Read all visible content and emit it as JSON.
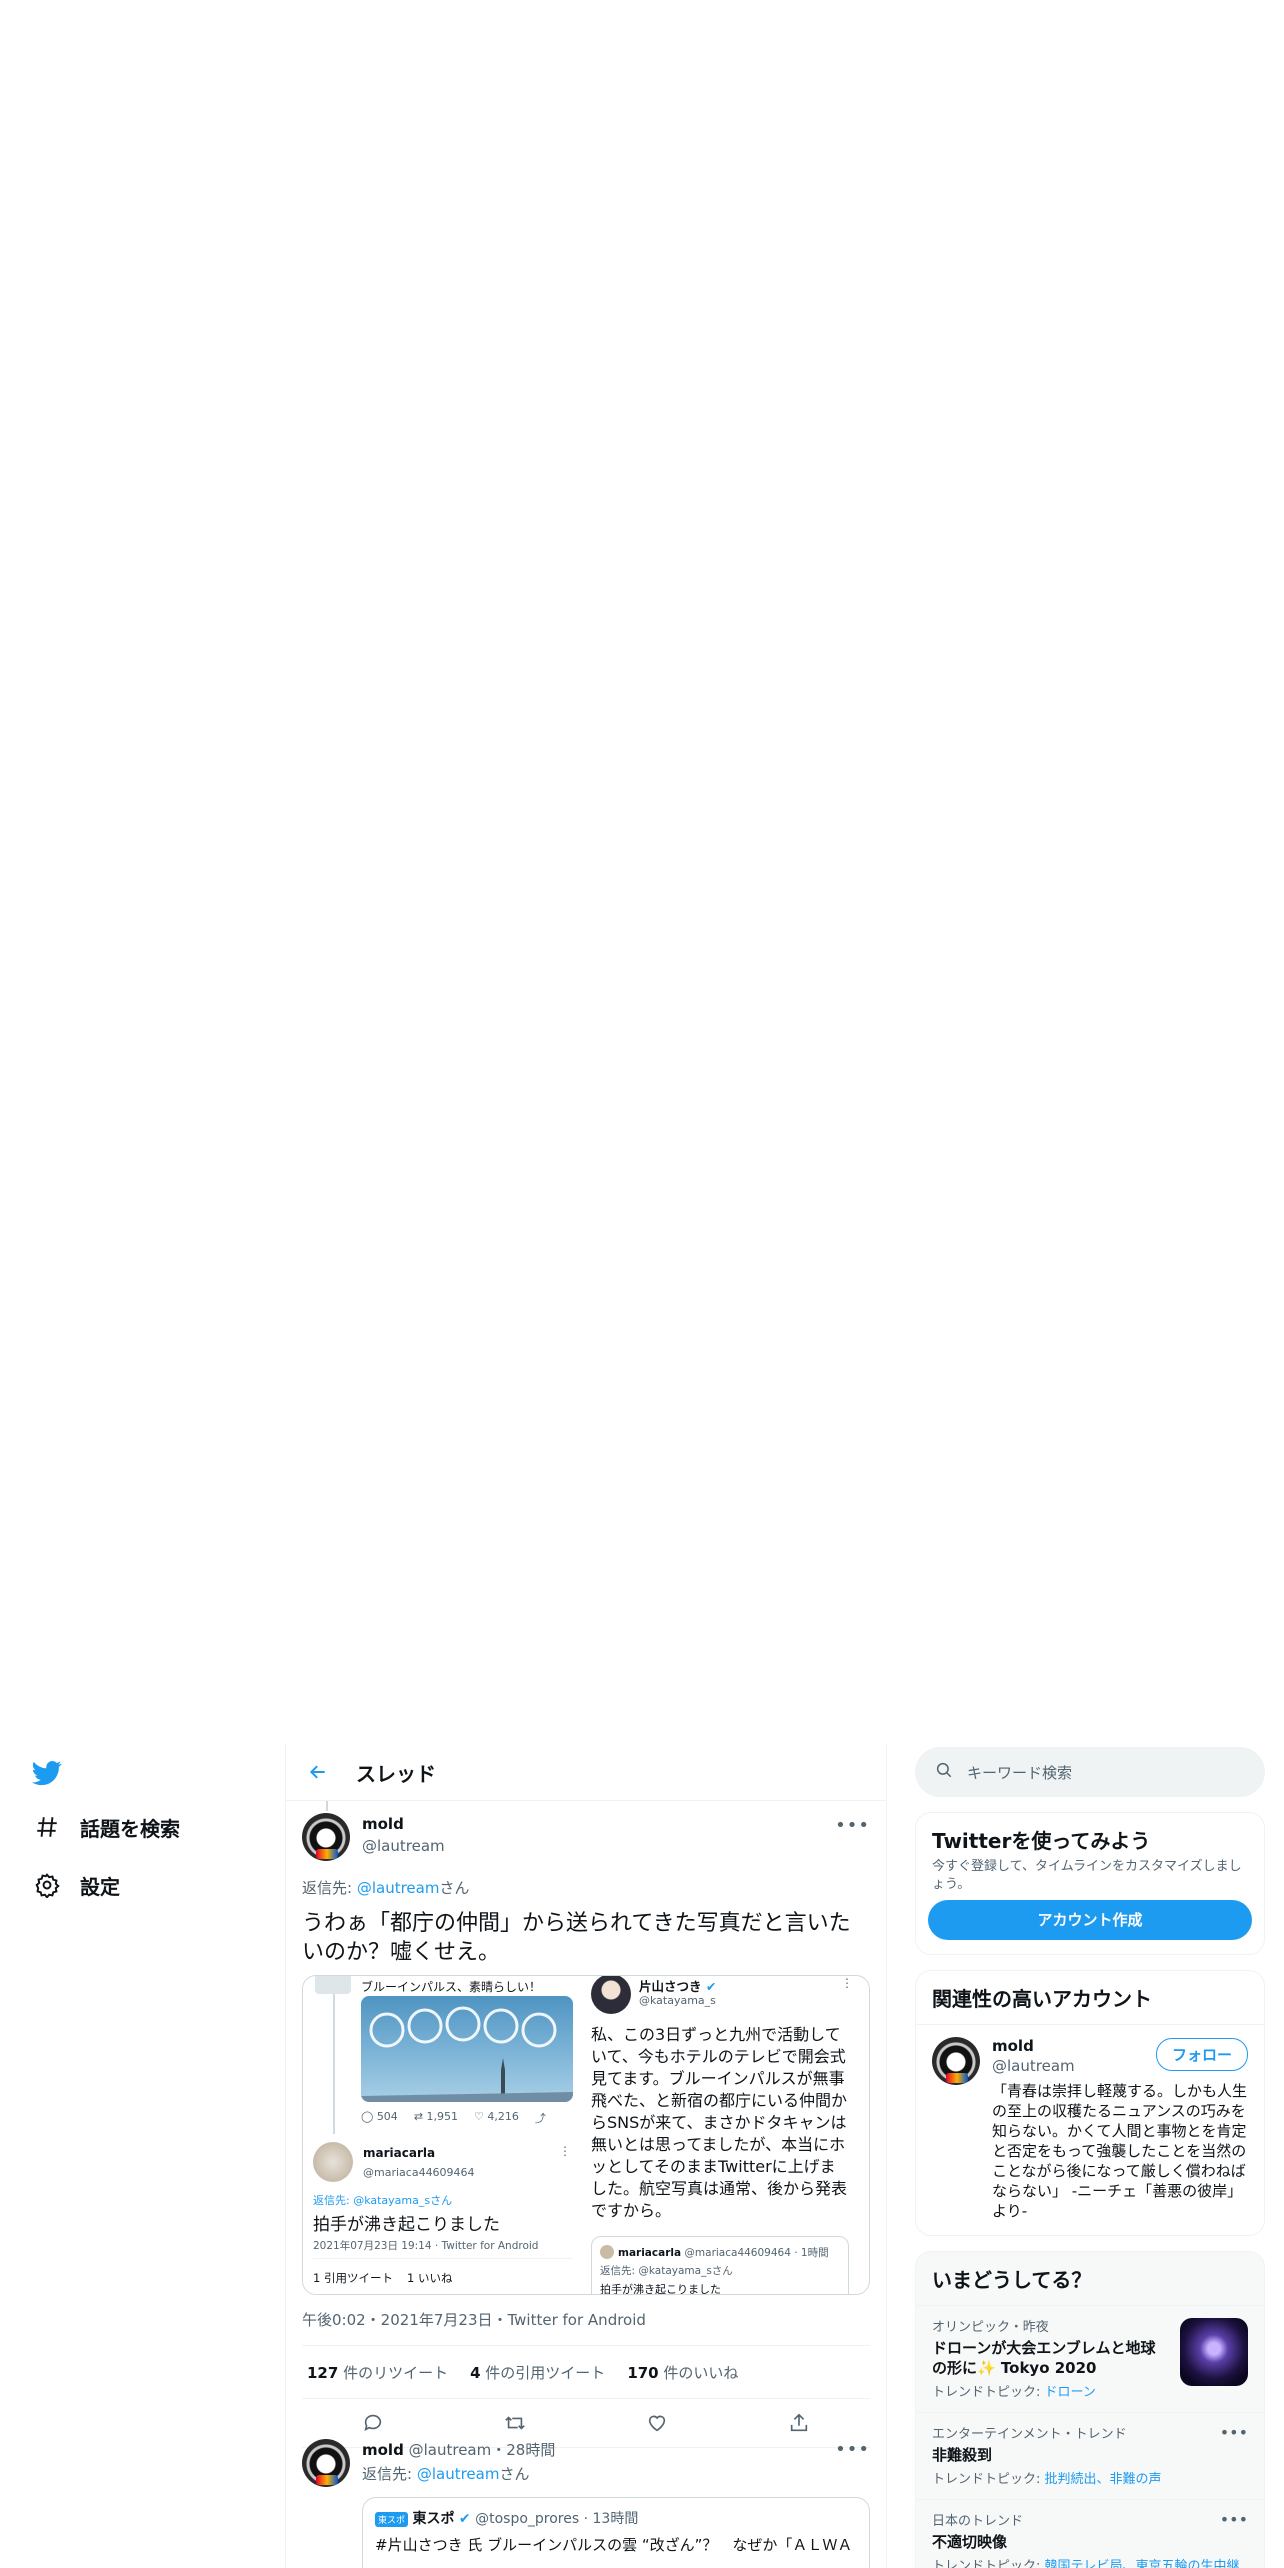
{
  "nav": {
    "explore_label": "話題を検索",
    "settings_label": "設定"
  },
  "header": {
    "title": "スレッド"
  },
  "main_tweet": {
    "name": "mold",
    "handle": "@lautream",
    "reply_prefix": "返信先: ",
    "reply_handle": "@lautream",
    "reply_suffix": "さん",
    "text": "うわぁ「都庁の仲間」から送られてきた写真だと言いたいのか？嘘くせえ。",
    "meta": "午後0:02・2021年7月23日・Twitter for Android"
  },
  "quoted_image": {
    "left_top_text": "ブルーインパルス、素晴らしい！",
    "left_actions": [
      "504",
      "1,951",
      "4,216"
    ],
    "left_user_name": "mariacarla",
    "left_user_handle": "@mariaca44609464",
    "left_reply": "返信先: @katayama_sさん",
    "left_text": "拍手が沸き起こりました",
    "left_date": "2021年07月23日 19:14 · Twitter for Android",
    "left_counts": [
      "1 引用ツイート",
      "1 いいね"
    ],
    "right_name": "片山さつき",
    "right_handle": "@katayama_s",
    "right_text": "私、この3日ずっと九州で活動していて、今もホテルのテレビで開会式見てます。ブルーインパルスが無事飛べた、と新宿の都庁にいる仲間からSNSが来て、まさかドタキャンは無いとは思ってましたが、本当にホッとしてそのままTwitterに上げました。航空写真は通常、後から発表ですから。",
    "right_nested_name": "mariacarla",
    "right_nested_meta": "@mariaca44609464 · 1時間",
    "right_nested_reply": "返信先: @katayama_sさん",
    "right_nested_text": "拍手が沸き起こりました"
  },
  "stats": {
    "retweets_num": "127",
    "retweets_label": " 件のリツイート",
    "quotes_num": "4",
    "quotes_label": " 件の引用ツイート",
    "likes_num": "170",
    "likes_label": " 件のいいね"
  },
  "reply_tweet": {
    "name": "mold",
    "handle_time": "@lautream・28時間",
    "reply_prefix": "返信先: ",
    "reply_handle": "@lautream",
    "reply_suffix": "さん",
    "quote_name": "東スポ",
    "quote_badge": "東スポ",
    "quote_handle_time": "@tospo_prores · 13時間",
    "quote_text": "#片山さつき 氏 ブルーインパルスの雲 “改ざん”？　なぜか「ＡＬＷＡ"
  },
  "search": {
    "placeholder": "キーワード検索"
  },
  "signup": {
    "title": "Twitterを使ってみよう",
    "desc": "今すぐ登録して、タイムラインをカスタマイズしましょう。",
    "button": "アカウント作成"
  },
  "related": {
    "title": "関連性の高いアカウント",
    "name": "mold",
    "handle": "@lautream",
    "follow": "フォロー",
    "bio": "「青春は崇拝し軽蔑する。しかも人生の至上の収穫たるニュアンスの巧みを知らない。かくて人間と事物とを肯定と否定をもって強襲したことを当然のことながら後になって厳しく償わねばならない」 -ニーチェ「善悪の彼岸」より-"
  },
  "trends": {
    "title": "いまどうしてる？",
    "items": [
      {
        "meta": "オリンピック・昨夜",
        "title": "ドローンが大会エンブレムと地球の形に✨ Tokyo 2020",
        "topic_prefix": "トレンドトピック: ",
        "topic": "ドローン"
      },
      {
        "meta": "エンターテインメント・トレンド",
        "title": "非難殺到",
        "topic_prefix": "トレンドトピック: ",
        "topic": "批判続出、非難の声"
      },
      {
        "meta": "日本のトレンド",
        "title": "不適切映像",
        "topic_prefix": "トレンドトピック: ",
        "topic": "韓国テレビ局、東京五輪の生中継"
      }
    ]
  }
}
